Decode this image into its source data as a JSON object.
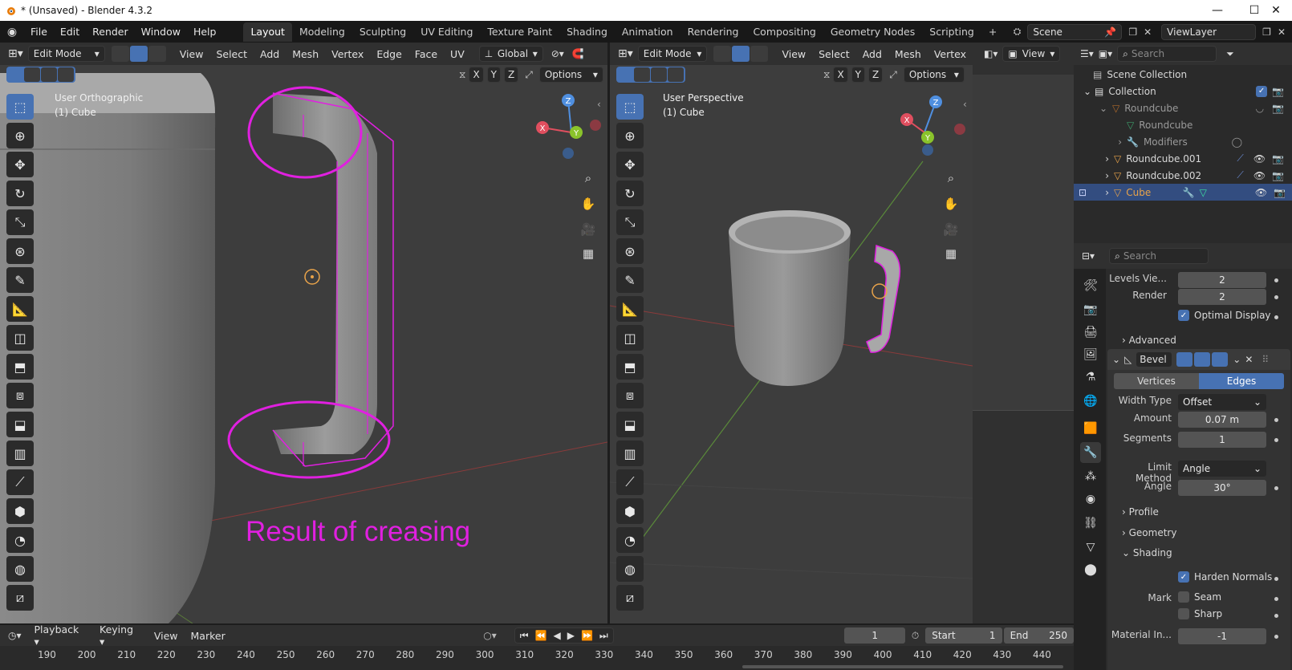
{
  "window": {
    "title": "* (Unsaved) - Blender 4.3.2",
    "controls": [
      "—",
      "☐",
      "✕"
    ]
  },
  "menu": [
    "File",
    "Edit",
    "Render",
    "Window",
    "Help"
  ],
  "workspaces": [
    "Layout",
    "Modeling",
    "Sculpting",
    "UV Editing",
    "Texture Paint",
    "Shading",
    "Animation",
    "Rendering",
    "Compositing",
    "Geometry Nodes",
    "Scripting"
  ],
  "workspace_add": "+",
  "scene": {
    "label": "Scene",
    "view_layer": "ViewLayer"
  },
  "viewport_left": {
    "mode": "Edit Mode",
    "menus": [
      "View",
      "Select",
      "Add",
      "Mesh",
      "Vertex",
      "Edge",
      "Face",
      "UV"
    ],
    "orientation": "Global",
    "axes": [
      "X",
      "Y",
      "Z"
    ],
    "options": "Options",
    "view_name": "User Orthographic",
    "object": "(1) Cube",
    "annotation": "Result of creasing",
    "annotation_color": "#e020e0"
  },
  "viewport_right": {
    "mode": "Edit Mode",
    "menus": [
      "View",
      "Select",
      "Add",
      "Mesh",
      "Vertex"
    ],
    "axes": [
      "X",
      "Y",
      "Z"
    ],
    "options": "Options",
    "view_name": "User Perspective",
    "object": "(1) Cube"
  },
  "gizmo_labels": {
    "x": "X",
    "y": "Y",
    "z": "Z"
  },
  "outliner": {
    "header_view": "View",
    "search_placeholder": "Search",
    "items": [
      {
        "label": "Scene Collection"
      },
      {
        "label": "Collection"
      },
      {
        "label": "Roundcube"
      },
      {
        "label": "Roundcube"
      },
      {
        "label": "Modifiers"
      },
      {
        "label": "Roundcube.001"
      },
      {
        "label": "Roundcube.002"
      },
      {
        "label": "Cube"
      }
    ]
  },
  "properties": {
    "search_placeholder": "Search",
    "levels_viewport": {
      "label": "Levels Vie...",
      "value": "2"
    },
    "render": {
      "label": "Render",
      "value": "2"
    },
    "optimal_display": "Optimal Display",
    "advanced": "Advanced",
    "modifier_name": "Bevel",
    "affect_tabs": [
      "Vertices",
      "Edges"
    ],
    "width_type": {
      "label": "Width Type",
      "value": "Offset"
    },
    "amount": {
      "label": "Amount",
      "value": "0.07 m"
    },
    "segments": {
      "label": "Segments",
      "value": "1"
    },
    "limit_method": {
      "label": "Limit Method",
      "value": "Angle"
    },
    "angle": {
      "label": "Angle",
      "value": "30°"
    },
    "profile": "Profile",
    "geometry": "Geometry",
    "shading": "Shading",
    "harden_normals": "Harden Normals",
    "mark_label": "Mark",
    "seam": "Seam",
    "sharp": "Sharp",
    "material_index": {
      "label": "Material In...",
      "value": "-1"
    }
  },
  "timeline": {
    "menus": [
      "Playback",
      "Keying",
      "View",
      "Marker"
    ],
    "current_frame": "1",
    "start_label": "Start",
    "start": "1",
    "end_label": "End",
    "end": "250",
    "ruler": [
      "190",
      "200",
      "210",
      "220",
      "230",
      "240",
      "250",
      "260",
      "270",
      "280",
      "290",
      "300",
      "310",
      "320",
      "330",
      "340",
      "350",
      "360",
      "370",
      "380",
      "390",
      "400",
      "410",
      "420",
      "430",
      "440"
    ]
  }
}
